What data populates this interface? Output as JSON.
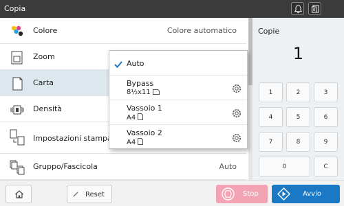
{
  "title": "Copia",
  "menu": {
    "rows": [
      {
        "label": "Colore",
        "value": "Colore automatico",
        "icon": "color-dots-icon"
      },
      {
        "label": "Zoom",
        "value": "",
        "icon": "zoom-icon"
      },
      {
        "label": "Carta",
        "value": "",
        "icon": "paper-icon",
        "selected": true
      },
      {
        "label": "Densità",
        "value": "",
        "icon": "density-icon"
      },
      {
        "label": "Impostazioni stampa d",
        "value": "",
        "icon": "print-settings-icon"
      },
      {
        "label": "Gruppo/Fascicola",
        "value": "Auto",
        "icon": "collate-icon"
      }
    ]
  },
  "dropdown": {
    "items": [
      {
        "line1": "Auto",
        "line2": "",
        "checked": true
      },
      {
        "line1": "Bypass",
        "line2": "8½x11",
        "icon": "paper-landscape-icon"
      },
      {
        "line1": "Vassoio  1",
        "line2": "A4",
        "icon": "paper-portrait-icon"
      },
      {
        "line1": "Vassoio  2",
        "line2": "A4",
        "icon": "paper-portrait-icon"
      }
    ]
  },
  "copies": {
    "label": "Copie",
    "value": "1"
  },
  "keypad": [
    "1",
    "2",
    "3",
    "4",
    "5",
    "6",
    "7",
    "8",
    "9",
    "0",
    "C"
  ],
  "bottom": {
    "reset": "Reset",
    "stop": "Stop",
    "avvio": "Avvio"
  },
  "colors": {
    "accent": "#1b78c4",
    "stop": "#f2a3b4",
    "selected_row": "#dce7ee",
    "titlebar": "#3b3b3b"
  }
}
